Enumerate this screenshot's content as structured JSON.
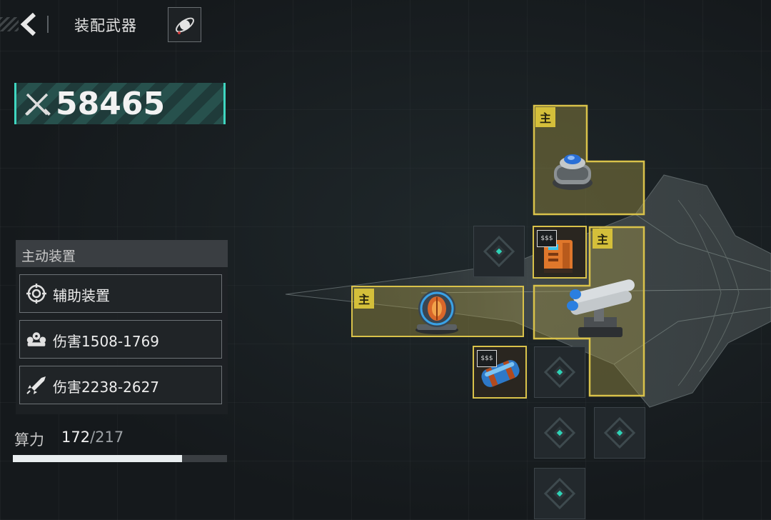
{
  "header": {
    "title": "装配武器",
    "back_icon": "chevron-left-icon",
    "title_icon": "planet-orbit-icon"
  },
  "power": {
    "icon": "crossed-swords-icon",
    "value": "58465"
  },
  "active_devices": {
    "title": "主动装置",
    "items": [
      {
        "icon": "target-reticle-icon",
        "label": "辅助装置"
      },
      {
        "icon": "drone-swarm-icon",
        "label": "伤害1508-1769"
      },
      {
        "icon": "missile-icon",
        "label": "伤害2238-2627"
      }
    ]
  },
  "compute": {
    "label": "算力",
    "current": "172",
    "separator": "/",
    "max": "217",
    "fraction": 0.79
  },
  "equipment": {
    "main_tag": "主",
    "sub_tag": "$$$",
    "slots": [
      {
        "type": "main",
        "icon": "shield-generator-icon"
      },
      {
        "type": "main",
        "icon": "twin-missile-launcher-icon"
      },
      {
        "type": "main",
        "icon": "energy-core-icon"
      },
      {
        "type": "sub",
        "icon": "orange-module-icon"
      },
      {
        "type": "sub",
        "icon": "blue-canister-icon"
      }
    ]
  },
  "colors": {
    "accent_teal": "#3fd6c0",
    "slot_gold": "#d9c24a",
    "bar_fill": "#e9eef0"
  }
}
